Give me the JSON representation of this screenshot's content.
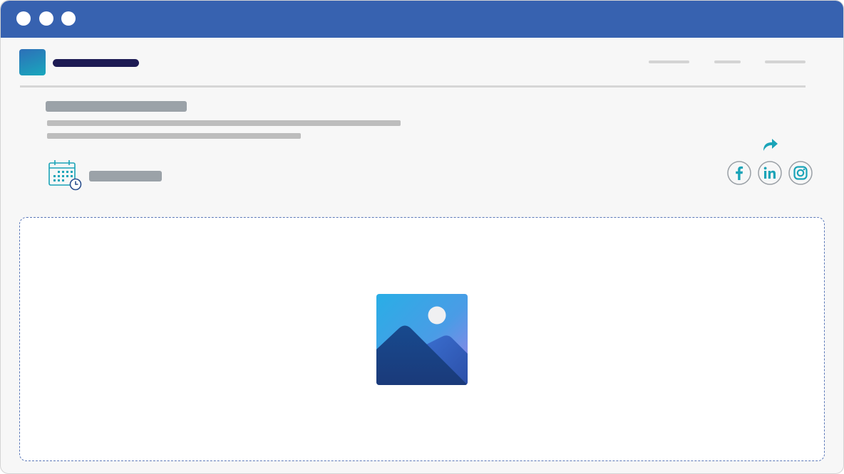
{
  "window": {
    "controls": [
      "window-dot",
      "window-dot",
      "window-dot"
    ]
  },
  "header": {
    "logo_colors": [
      "#2d6fb8",
      "#19a8bd"
    ],
    "nav_links": 3
  },
  "article": {
    "icons": {
      "date": "calendar-clock-icon",
      "share": "share-arrow-icon",
      "social": [
        "facebook-icon",
        "linkedin-icon",
        "instagram-icon"
      ],
      "media": "image-placeholder-icon"
    }
  },
  "colors": {
    "titlebar": "#3762b0",
    "accent": "#1aa4b8",
    "skeleton_dark": "#9ba2a8",
    "skeleton_light": "#bdbdbd",
    "site_name": "#1d1b54"
  }
}
